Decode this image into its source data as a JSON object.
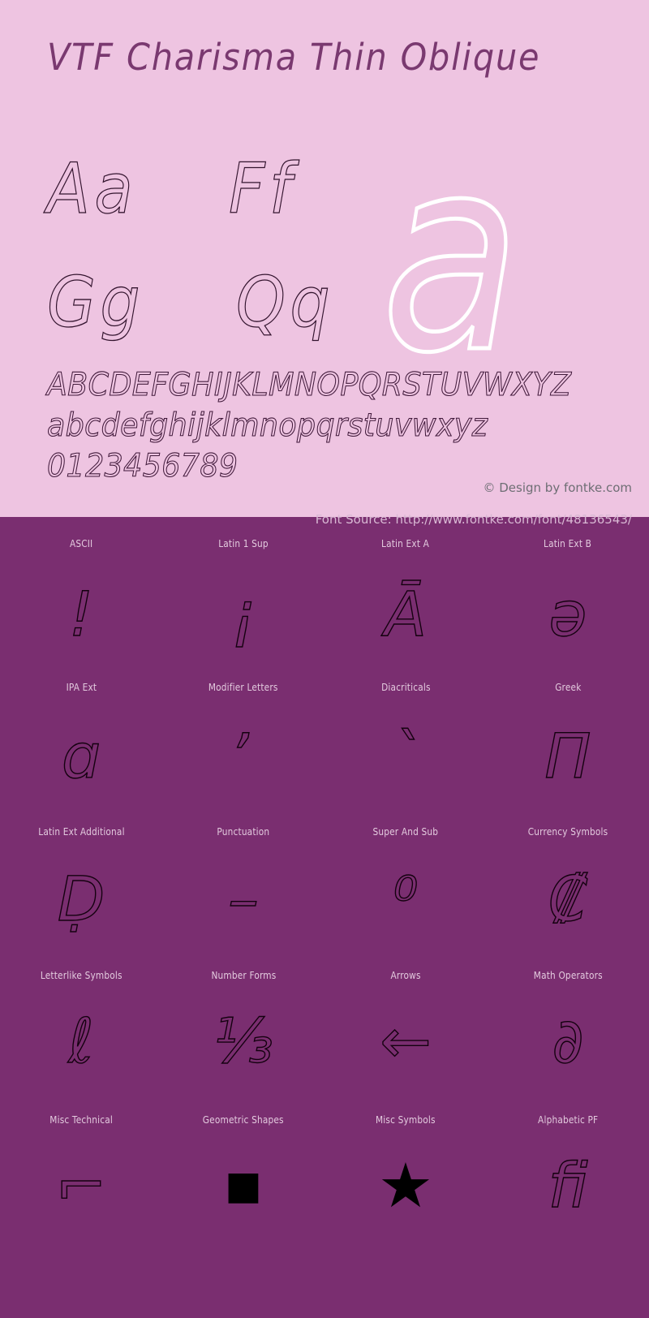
{
  "hero": {
    "title": "VTF Charisma Thin Oblique",
    "showcase_glyph": "a",
    "pairs": [
      "Aa",
      "Ff",
      "Gg",
      "Qq"
    ],
    "alphabet_upper": "ABCDEFGHIJKLMNOPQRSTUVWXYZ",
    "alphabet_lower": "abcdefghijklmnopqrstuvwxyz",
    "digits": "0123456789",
    "credit": "© Design by fontke.com",
    "bg_color": "#eec4e1",
    "text_color": "#6e2a64"
  },
  "lower": {
    "source": "Font Source: http://www.fontke.com/font/48136543/",
    "bg_color": "#7a2e70",
    "label_color": "#e3cade",
    "rows": [
      {
        "cells": [
          {
            "label": "ASCII",
            "glyph": "!",
            "solid": false
          },
          {
            "label": "Latin 1 Sup",
            "glyph": "¡",
            "solid": false
          },
          {
            "label": "Latin Ext A",
            "glyph": "Ā",
            "solid": false
          },
          {
            "label": "Latin Ext B",
            "glyph": "ə",
            "solid": false
          }
        ]
      },
      {
        "cells": [
          {
            "label": "IPA Ext",
            "glyph": "ɑ",
            "solid": false
          },
          {
            "label": "Modifier Letters",
            "glyph": "ʼ",
            "solid": false
          },
          {
            "label": "Diacriticals",
            "glyph": "ˋ",
            "solid": false
          },
          {
            "label": "Greek",
            "glyph": "Π",
            "solid": false
          }
        ]
      },
      {
        "cells": [
          {
            "label": "Latin Ext Additional",
            "glyph": "Ḍ",
            "solid": false
          },
          {
            "label": "Punctuation",
            "glyph": "–",
            "solid": false
          },
          {
            "label": "Super And Sub",
            "glyph": "⁰",
            "solid": false
          },
          {
            "label": "Currency Symbols",
            "glyph": "₡",
            "solid": false
          }
        ]
      },
      {
        "cells": [
          {
            "label": "Letterlike Symbols",
            "glyph": "ℓ",
            "solid": false
          },
          {
            "label": "Number Forms",
            "glyph": "⅓",
            "solid": false
          },
          {
            "label": "Arrows",
            "glyph": "←",
            "solid": false
          },
          {
            "label": "Math Operators",
            "glyph": "∂",
            "solid": false
          }
        ]
      },
      {
        "cells": [
          {
            "label": "Misc Technical",
            "glyph": "⌐",
            "solid": false
          },
          {
            "label": "Geometric Shapes",
            "glyph": "■",
            "solid": true
          },
          {
            "label": "Misc Symbols",
            "glyph": "★",
            "solid": true
          },
          {
            "label": "Alphabetic PF",
            "glyph": "ﬁ",
            "solid": false
          }
        ]
      }
    ]
  }
}
